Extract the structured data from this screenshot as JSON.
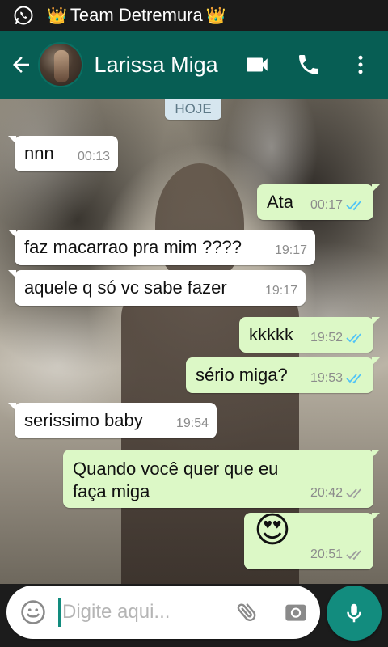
{
  "status_bar": {
    "title": "Team Detremura",
    "decorations": [
      "👑",
      "👑"
    ]
  },
  "header": {
    "contact_name": "Larissa Miga"
  },
  "chat": {
    "date_label": "HOJE",
    "messages": [
      {
        "dir": "in",
        "text": "nnn",
        "time": "00:13"
      },
      {
        "dir": "out",
        "text": "Ata",
        "time": "00:17",
        "read": true
      },
      {
        "dir": "in",
        "text": "faz macarrao pra mim ????",
        "time": "19:17"
      },
      {
        "dir": "in",
        "text": "aquele q só vc sabe fazer",
        "time": "19:17"
      },
      {
        "dir": "out",
        "text": "kkkkk",
        "time": "19:52",
        "read": true
      },
      {
        "dir": "out",
        "text": "sério miga?",
        "time": "19:53",
        "read": true
      },
      {
        "dir": "in",
        "text": "serissimo baby",
        "time": "19:54"
      },
      {
        "dir": "out",
        "text": "Quando você quer que eu faça miga",
        "time": "20:42",
        "read": false
      },
      {
        "dir": "out",
        "text": "😍",
        "time": "20:51",
        "read": false
      }
    ]
  },
  "composer": {
    "placeholder": "Digite aqui..."
  },
  "colors": {
    "header": "#075e54",
    "accent": "#128c7e",
    "outgoing_bubble": "#dcf8c6",
    "incoming_bubble": "#ffffff",
    "read_ticks": "#4fc3f7",
    "sent_ticks": "#9e9e9e"
  },
  "icons": {
    "status_app": "whatsapp-icon",
    "back": "arrow-back-icon",
    "video": "video-call-icon",
    "call": "phone-icon",
    "menu": "more-vert-icon",
    "emoji": "emoji-icon",
    "attach": "paperclip-icon",
    "camera": "camera-icon",
    "mic": "mic-icon"
  }
}
